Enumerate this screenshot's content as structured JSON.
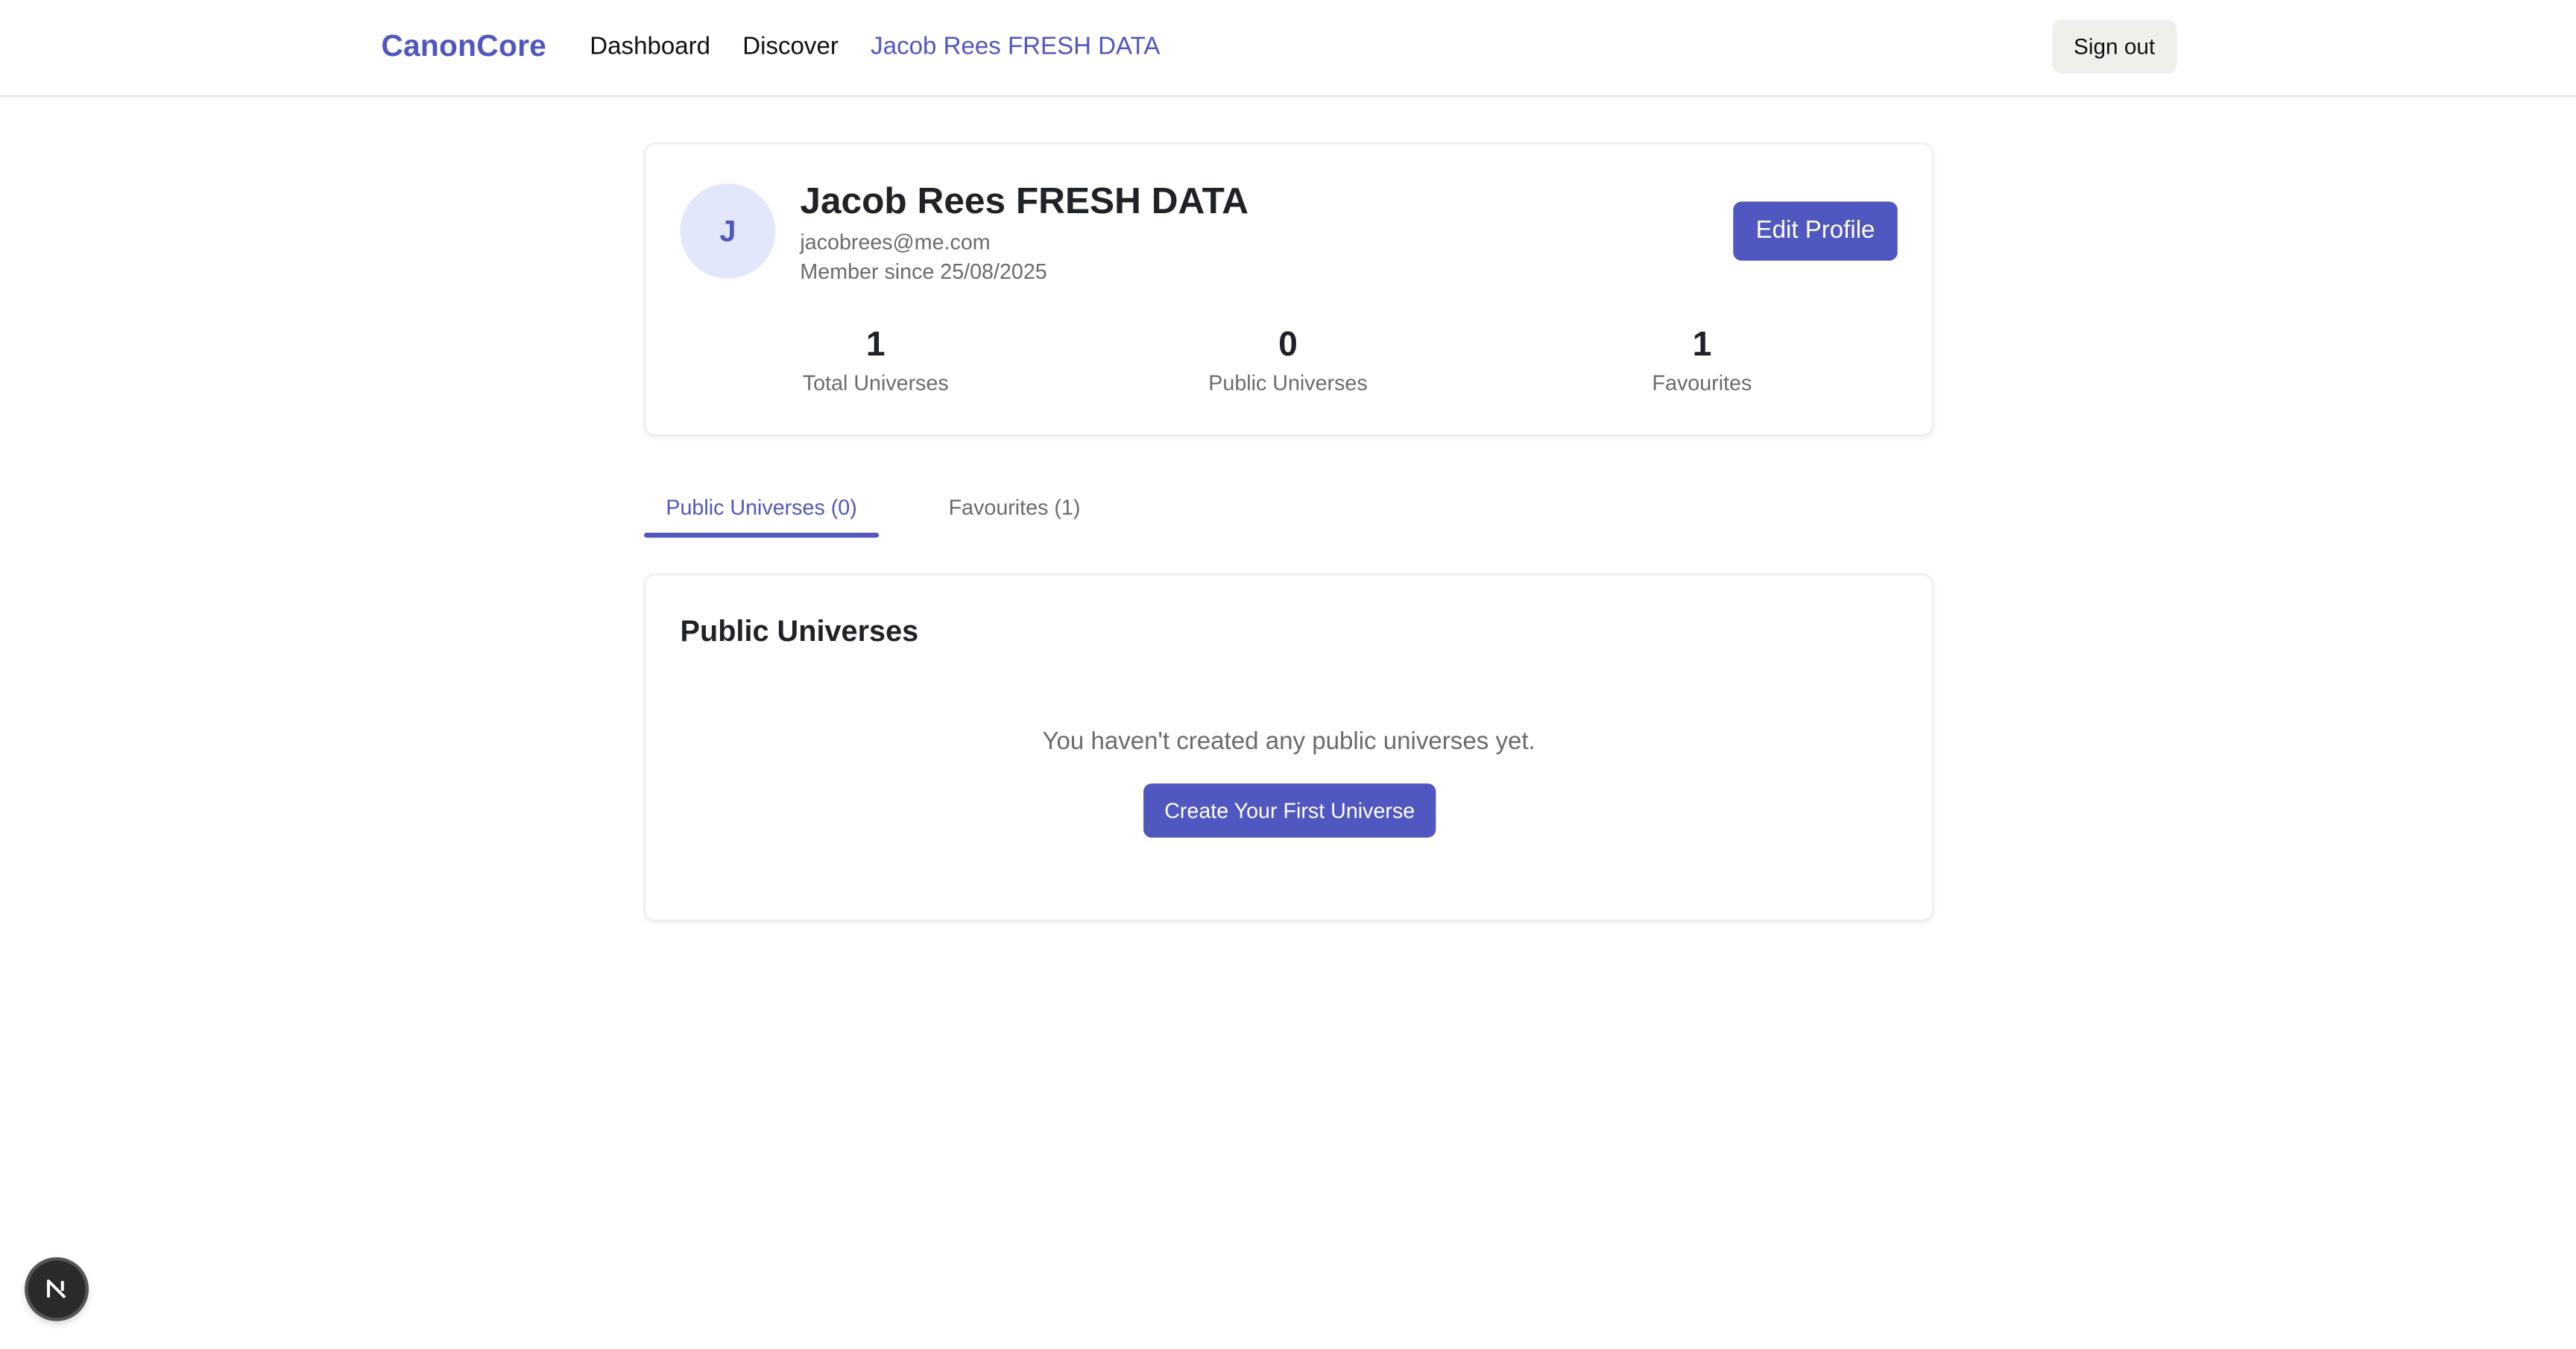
{
  "nav": {
    "brand": "CanonCore",
    "links": [
      {
        "label": "Dashboard",
        "active": false
      },
      {
        "label": "Discover",
        "active": false
      },
      {
        "label": "Jacob Rees FRESH DATA",
        "active": true
      }
    ],
    "sign_out": "Sign out"
  },
  "profile": {
    "avatar_initial": "J",
    "name": "Jacob Rees FRESH DATA",
    "email": "jacobrees@me.com",
    "member_since": "Member since 25/08/2025",
    "edit_button": "Edit Profile",
    "stats": [
      {
        "value": "1",
        "label": "Total Universes"
      },
      {
        "value": "0",
        "label": "Public Universes"
      },
      {
        "value": "1",
        "label": "Favourites"
      }
    ]
  },
  "tabs": [
    {
      "label": "Public Universes (0)",
      "active": true
    },
    {
      "label": "Favourites (1)",
      "active": false
    }
  ],
  "public_universes": {
    "title": "Public Universes",
    "empty_message": "You haven't created any public universes yet.",
    "create_button": "Create Your First Universe"
  },
  "dev_indicator": {
    "icon": "nextjs-logo-icon"
  },
  "colors": {
    "accent": "#5157c0",
    "avatar_bg": "#e2e7fb",
    "muted_text": "#6b6b6b",
    "sign_out_bg": "#f0efec"
  }
}
